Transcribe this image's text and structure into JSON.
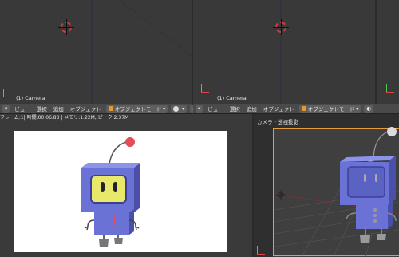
{
  "viewports": {
    "top_left_label": "(1) Camera",
    "top_mid_label": "(1) Camera"
  },
  "header_left": {
    "view": "ビュー",
    "select": "選択",
    "add": "追加",
    "object": "オブジェクト",
    "mode": "オブジェクトモード"
  },
  "header_right": {
    "view": "ビュー",
    "select": "選択",
    "add": "追加",
    "object": "オブジェクト",
    "mode": "オブジェクトモード"
  },
  "render_info": "フレーム:1| 時間:00:06.83 | メモリ:1.22M, ピーク:2.37M",
  "camera_view": {
    "label": "カメラ・透視投影"
  },
  "colors": {
    "robot_body": "#6b72d6",
    "robot_screen": "#e8e86a",
    "antenna_ball": "#e84a5a",
    "camera_frame": "#e69b3c",
    "accent_orange": "#e29b34"
  }
}
